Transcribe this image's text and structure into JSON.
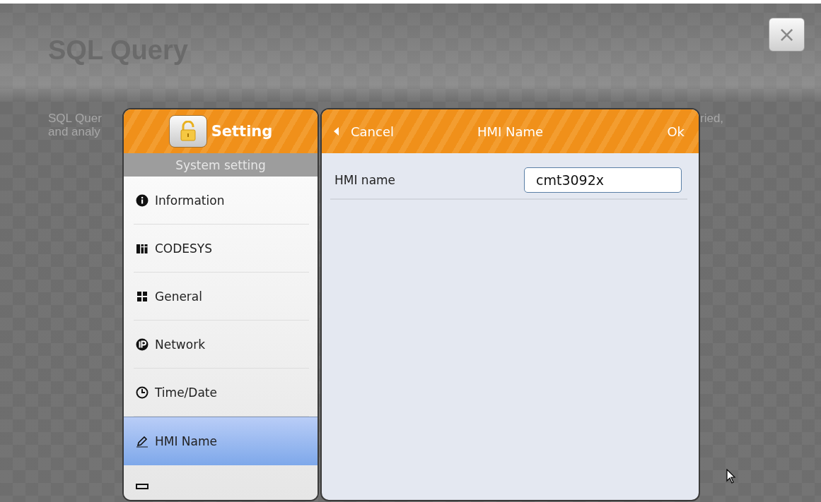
{
  "background": {
    "title": "SQL Query",
    "description_left": [
      "SQL Quer",
      "and analy"
    ],
    "description_right": "ried,"
  },
  "close_button": {
    "label": "×"
  },
  "sidebar": {
    "title": "Setting",
    "subtitle": "System setting",
    "items": [
      {
        "label": "Information",
        "kind": "info",
        "selected": false
      },
      {
        "label": "CODESYS",
        "kind": "codesys",
        "selected": false
      },
      {
        "label": "General",
        "kind": "grid",
        "selected": false
      },
      {
        "label": "Network",
        "kind": "ip",
        "selected": false
      },
      {
        "label": "Time/Date",
        "kind": "clock",
        "selected": false
      },
      {
        "label": "HMI Name",
        "kind": "pen",
        "selected": true
      }
    ]
  },
  "panel": {
    "back_button": "Cancel",
    "title": "HMI Name",
    "ok_button": "Ok",
    "fields": [
      {
        "label": "HMI name",
        "value": "cmt3092x"
      }
    ]
  }
}
